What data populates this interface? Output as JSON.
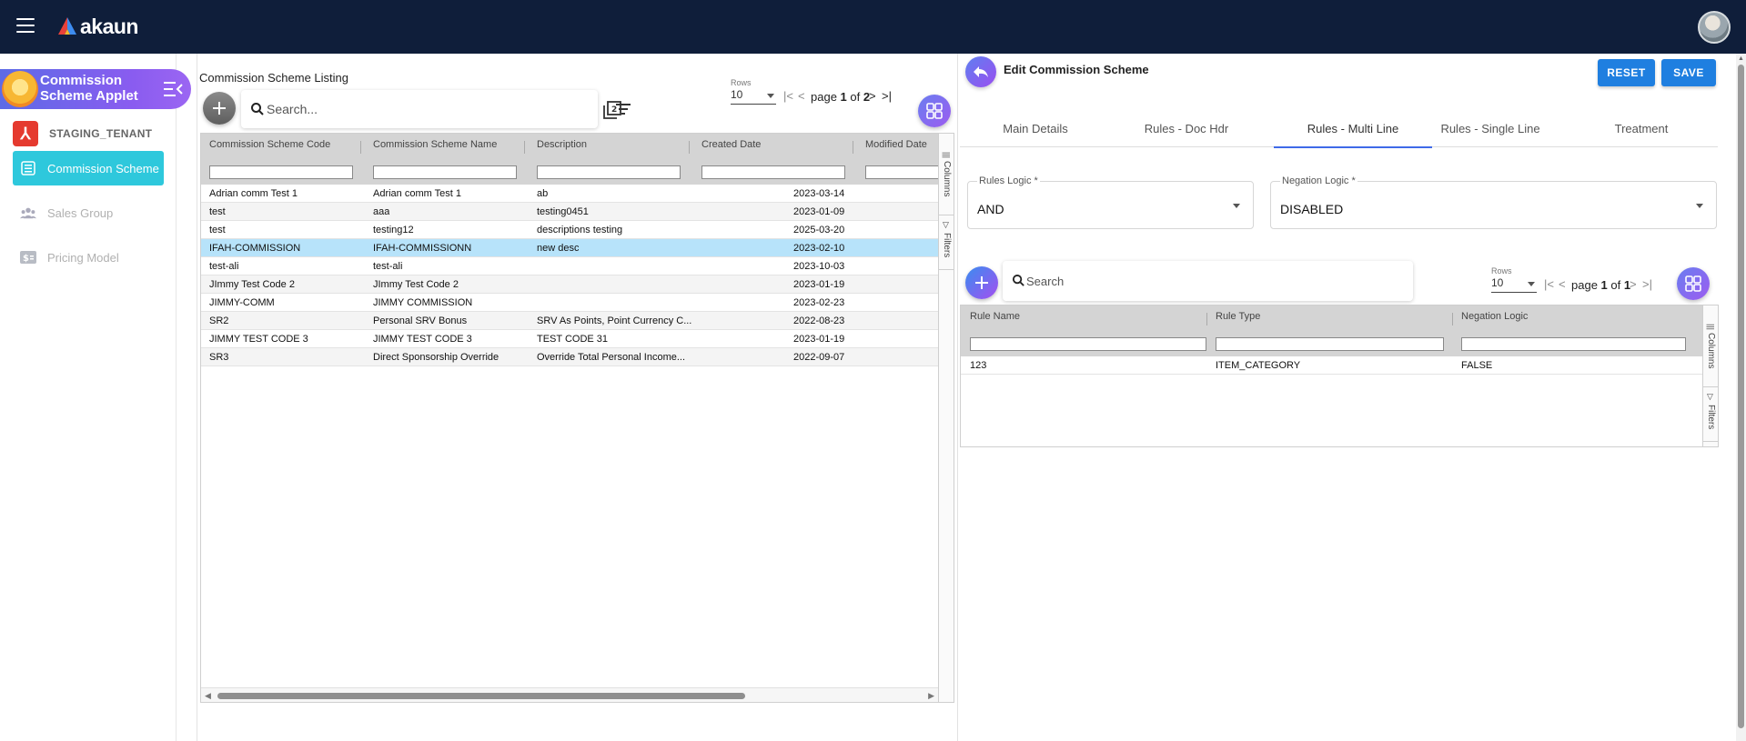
{
  "app": {
    "logo_text": "akaun"
  },
  "sidebar": {
    "applet_title": "Commission Scheme Applet",
    "tenant": "STAGING_TENANT",
    "items": [
      {
        "label": "Commission Scheme",
        "icon": "list-icon",
        "active": true
      },
      {
        "label": "Sales Group",
        "icon": "group-icon",
        "active": false
      },
      {
        "label": "Pricing Model",
        "icon": "dollar-icon",
        "active": false
      }
    ]
  },
  "listing": {
    "title": "Commission Scheme Listing",
    "search_placeholder": "Search...",
    "rows_label": "Rows",
    "rows_value": "10",
    "page_prefix": "page",
    "page_current": "1",
    "page_of": "of",
    "page_total": "2",
    "columns": [
      "Commission Scheme Code",
      "Commission Scheme Name",
      "Description",
      "Created Date",
      "Modified Date"
    ],
    "side_tabs": [
      "Columns",
      "Filters"
    ],
    "rows": [
      {
        "code": "Adrian comm Test 1",
        "name": "Adrian comm Test 1",
        "desc": "ab",
        "created": "2023-03-14"
      },
      {
        "code": "test",
        "name": "aaa",
        "desc": "testing0451",
        "created": "2023-01-09"
      },
      {
        "code": "test",
        "name": "testing12",
        "desc": "descriptions testing",
        "created": "2025-03-20"
      },
      {
        "code": "IFAH-COMMISSION",
        "name": "IFAH-COMMISSIONN",
        "desc": "new desc",
        "created": "2023-02-10"
      },
      {
        "code": "test-ali",
        "name": "test-ali",
        "desc": "",
        "created": "2023-10-03"
      },
      {
        "code": "JImmy Test Code 2",
        "name": "JImmy Test Code 2",
        "desc": "",
        "created": "2023-01-19"
      },
      {
        "code": "JIMMY-COMM",
        "name": "JIMMY COMMISSION",
        "desc": "",
        "created": "2023-02-23"
      },
      {
        "code": "SR2",
        "name": "Personal SRV Bonus",
        "desc": "SRV As Points, Point Currency C...",
        "created": "2022-08-23"
      },
      {
        "code": "JIMMY TEST CODE 3",
        "name": "JIMMY TEST CODE 3",
        "desc": "TEST CODE 31",
        "created": "2023-01-19"
      },
      {
        "code": "SR3",
        "name": "Direct Sponsorship Override",
        "desc": "Override Total Personal Income...",
        "created": "2022-09-07"
      }
    ]
  },
  "edit": {
    "title": "Edit Commission Scheme",
    "reset_label": "RESET",
    "save_label": "SAVE",
    "tabs": [
      "Main Details",
      "Rules - Doc Hdr",
      "Rules - Multi Line",
      "Rules - Single Line",
      "Treatment"
    ],
    "rules_logic_label": "Rules Logic *",
    "rules_logic_value": "AND",
    "negation_logic_label": "Negation Logic *",
    "negation_logic_value": "DISABLED",
    "search_placeholder": "Search",
    "rows_label": "Rows",
    "rows_value": "10",
    "page_prefix": "page",
    "page_current": "1",
    "page_of": "of",
    "page_total": "1",
    "columns": [
      "Rule Name",
      "Rule Type",
      "Negation Logic"
    ],
    "side_tabs": [
      "Columns",
      "Filters"
    ],
    "rows": [
      {
        "rule_name": "123",
        "rule_type": "ITEM_CATEGORY",
        "negation": "FALSE"
      }
    ]
  },
  "colors": {
    "topbar": "#0f1e3a",
    "active_nav": "#2ec8dc",
    "primary_button": "#1f7fe0",
    "selected_row": "#b7e3fa"
  }
}
